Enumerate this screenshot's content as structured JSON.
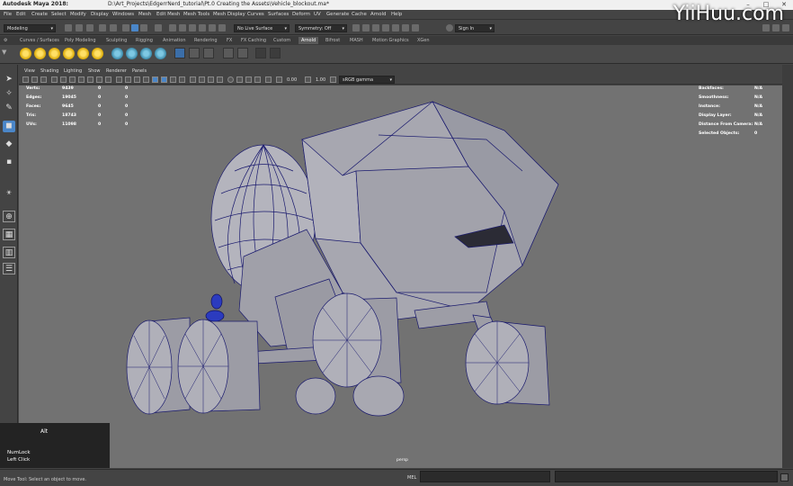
{
  "titlebar": {
    "app": "Autodesk Maya 2018:",
    "path": "D:\\Art_Projects\\EdgerrNerd_tutorial\\Pt.0 Creating the Assets\\Vehicle_blockout.ma*"
  },
  "menubar": [
    "File",
    "Edit",
    "Create",
    "Select",
    "Modify",
    "Display",
    "Windows",
    "Mesh",
    "Edit Mesh",
    "Mesh Tools",
    "Mesh Display",
    "Curves",
    "Surfaces",
    "Deform",
    "UV",
    "Generate",
    "Cache",
    "Arnold",
    "Help"
  ],
  "statusline": {
    "mode": "Modeling",
    "live_surface": "No Live Surface",
    "symmetry": "Symmetry: Off",
    "sign_in": "Sign In"
  },
  "shelf_tabs": [
    "Curves / Surfaces",
    "Poly Modeling",
    "Sculpting",
    "Rigging",
    "Animation",
    "Rendering",
    "FX",
    "FX Caching",
    "Custom",
    "Arnold",
    "Bifrost",
    "MASH",
    "Motion Graphics",
    "XGen"
  ],
  "active_shelf_tab": "Arnold",
  "panel_menu": [
    "View",
    "Shading",
    "Lighting",
    "Show",
    "Renderer",
    "Panels"
  ],
  "panel_tools": {
    "value_a": "0.00",
    "value_b": "1.00",
    "color_space": "sRGB gamma"
  },
  "hud_left": [
    {
      "label": "Verts:",
      "v1": "9439",
      "v2": "0",
      "v3": "0"
    },
    {
      "label": "Edges:",
      "v1": "19045",
      "v2": "0",
      "v3": "0"
    },
    {
      "label": "Faces:",
      "v1": "9645",
      "v2": "0",
      "v3": "0"
    },
    {
      "label": "Tris:",
      "v1": "18743",
      "v2": "0",
      "v3": "0"
    },
    {
      "label": "UVs:",
      "v1": "11098",
      "v2": "0",
      "v3": "0"
    }
  ],
  "hud_right": [
    {
      "label": "Backfaces:",
      "value": "N/A"
    },
    {
      "label": "Smoothness:",
      "value": "N/A"
    },
    {
      "label": "Instance:",
      "value": "N/A"
    },
    {
      "label": "Display Layer:",
      "value": "N/A"
    },
    {
      "label": "Distance From Camera:",
      "value": "N/A"
    },
    {
      "label": "Selected Objects:",
      "value": "0"
    }
  ],
  "camera_label": "persp",
  "key_panel": {
    "key": "Alt",
    "line1": "NumLock",
    "line2": "Left Click"
  },
  "helpline": "Move Tool: Select an object to move.",
  "mel_label": "MEL",
  "watermark": "YiiHuu.com",
  "colors": {
    "wire": "#1a1a6e",
    "mesh": "#a9a9b3",
    "viewport_bg": "#727272",
    "active_tab": "#5a5a5a"
  }
}
